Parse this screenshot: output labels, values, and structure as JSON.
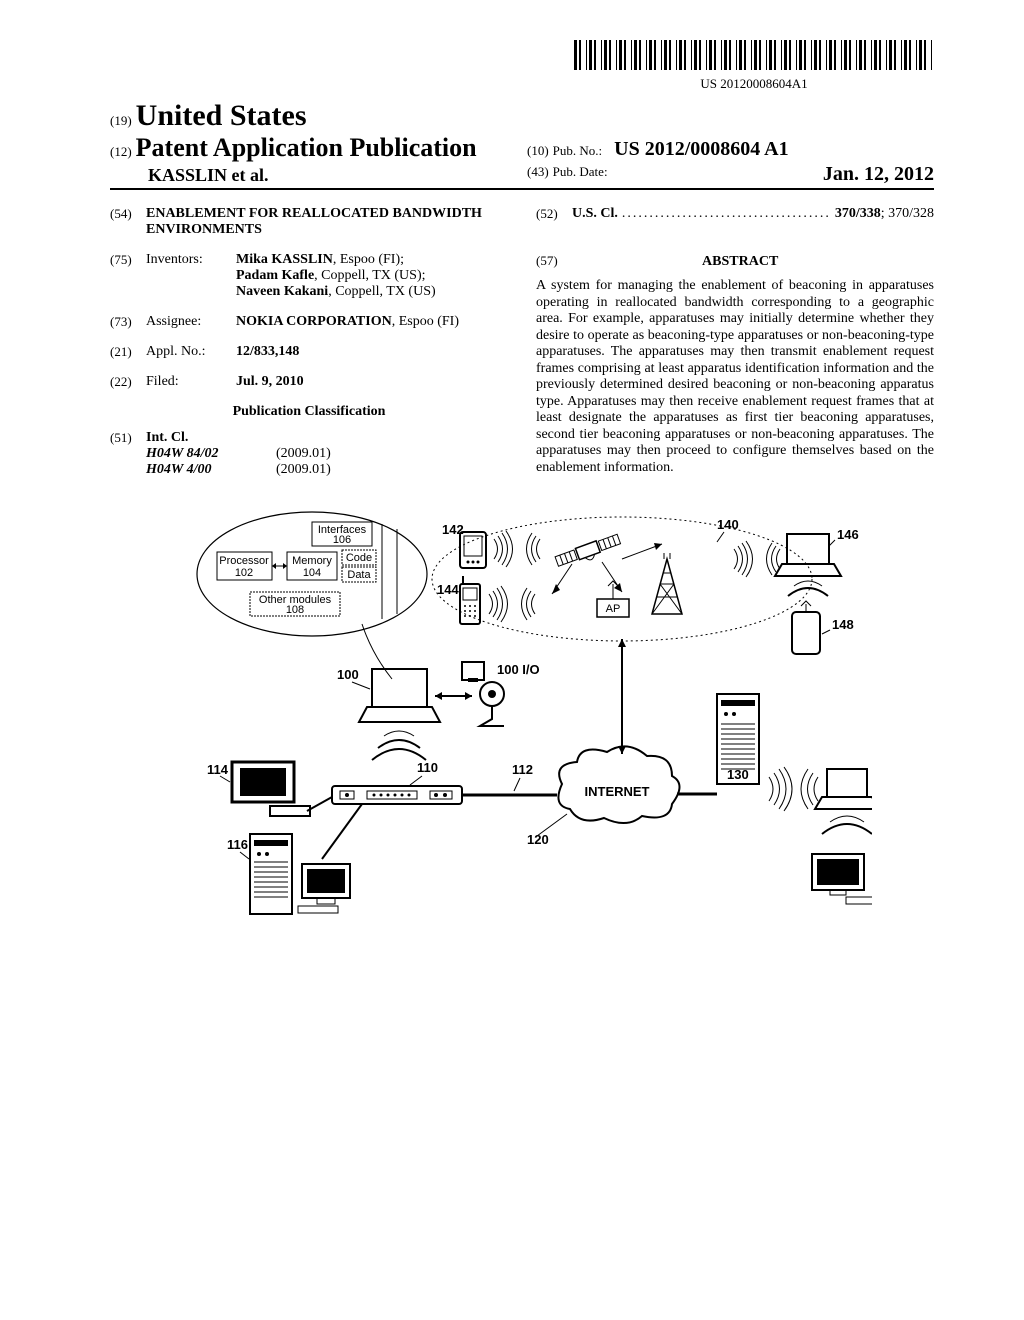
{
  "barcode_number": "US 20120008604A1",
  "header": {
    "code19": "(19)",
    "country": "United States",
    "code12": "(12)",
    "pub_type": "Patent Application Publication",
    "authors_line": "KASSLIN et al.",
    "code10": "(10)",
    "pubno_label": "Pub. No.:",
    "pubno": "US 2012/0008604 A1",
    "code43": "(43)",
    "pubdate_label": "Pub. Date:",
    "pubdate": "Jan. 12, 2012"
  },
  "biblio": {
    "title_code": "(54)",
    "title": "ENABLEMENT FOR REALLOCATED BANDWIDTH ENVIRONMENTS",
    "inv_code": "(75)",
    "inv_label": "Inventors:",
    "inventors": [
      {
        "name": "Mika KASSLIN",
        "loc": ", Espoo (FI);"
      },
      {
        "name": "Padam Kafle",
        "loc": ", Coppell, TX (US);"
      },
      {
        "name": "Naveen Kakani",
        "loc": ", Coppell, TX (US)"
      }
    ],
    "assignee_code": "(73)",
    "assignee_label": "Assignee:",
    "assignee_name": "NOKIA CORPORATION",
    "assignee_loc": ", Espoo (FI)",
    "applno_code": "(21)",
    "applno_label": "Appl. No.:",
    "applno": "12/833,148",
    "filed_code": "(22)",
    "filed_label": "Filed:",
    "filed": "Jul. 9, 2010",
    "pub_class_heading": "Publication Classification",
    "intcl_code": "(51)",
    "intcl_label": "Int. Cl.",
    "intcl": [
      {
        "code": "H04W 84/02",
        "date": "(2009.01)"
      },
      {
        "code": "H04W 4/00",
        "date": "(2009.01)"
      }
    ],
    "uscl_code": "(52)",
    "uscl_label": "U.S. Cl.",
    "uscl_main": "370/338",
    "uscl_sec": "; 370/328",
    "abstract_code": "(57)",
    "abstract_label": "ABSTRACT",
    "abstract_text": "A system for managing the enablement of beaconing in apparatuses operating in reallocated bandwidth corresponding to a geographic area. For example, apparatuses may initially determine whether they desire to operate as beaconing-type apparatuses or non-beaconing-type apparatuses. The apparatuses may then transmit enablement request frames comprising at least apparatus identification information and the previously determined desired beaconing or non-beaconing apparatus type. Apparatuses may then receive enablement request frames that at least designate the apparatuses as first tier beaconing apparatuses, second tier beaconing apparatuses or non-beaconing apparatuses. The apparatuses may then proceed to configure themselves based on the enablement information."
  },
  "figure": {
    "labels": {
      "processor": "Processor",
      "processor_n": "102",
      "memory": "Memory",
      "memory_n": "104",
      "code": "Code",
      "data": "Data",
      "interfaces": "Interfaces",
      "interfaces_n": "106",
      "other": "Other modules",
      "other_n": "108",
      "n100": "100",
      "n100io": "100 I/O",
      "n110": "110",
      "n112": "112",
      "n114": "114",
      "n116": "116",
      "n120": "120",
      "n130": "130",
      "n140": "140",
      "n142": "142",
      "n144": "144",
      "n146": "146",
      "n148": "148",
      "ap": "AP",
      "internet": "INTERNET"
    }
  }
}
